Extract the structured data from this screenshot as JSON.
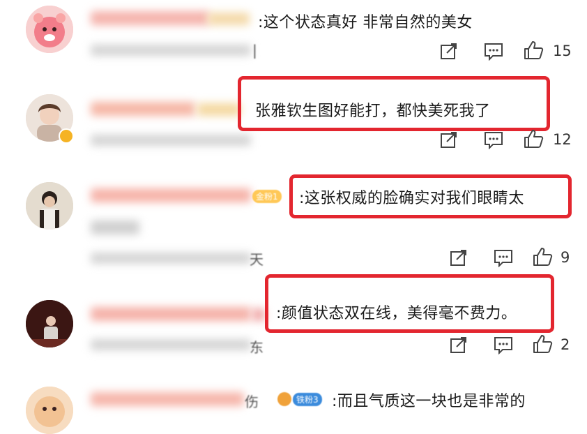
{
  "comments": [
    {
      "text": ":这个状态真好 非常自然的美女",
      "likes": "15"
    },
    {
      "text": "张雅钦生图好能打，都快美死我了",
      "likes": "12"
    },
    {
      "text": ":这张权威的脸确实对我们眼睛太",
      "likes": "9",
      "badge": "金粉1"
    },
    {
      "text": ":颜值状态双在线，美得毫不费力。",
      "likes": "2"
    },
    {
      "text": ":而且气质这一块也是非常的",
      "likes": "",
      "badge": "铁粉3"
    }
  ],
  "partial_chars": [
    "天",
    "东",
    "伤"
  ],
  "colors": {
    "highlight": "#e3262f",
    "icon": "#444444"
  },
  "icons": {
    "share": "share-icon",
    "reply": "comment-icon",
    "like": "thumbs-up-icon"
  }
}
